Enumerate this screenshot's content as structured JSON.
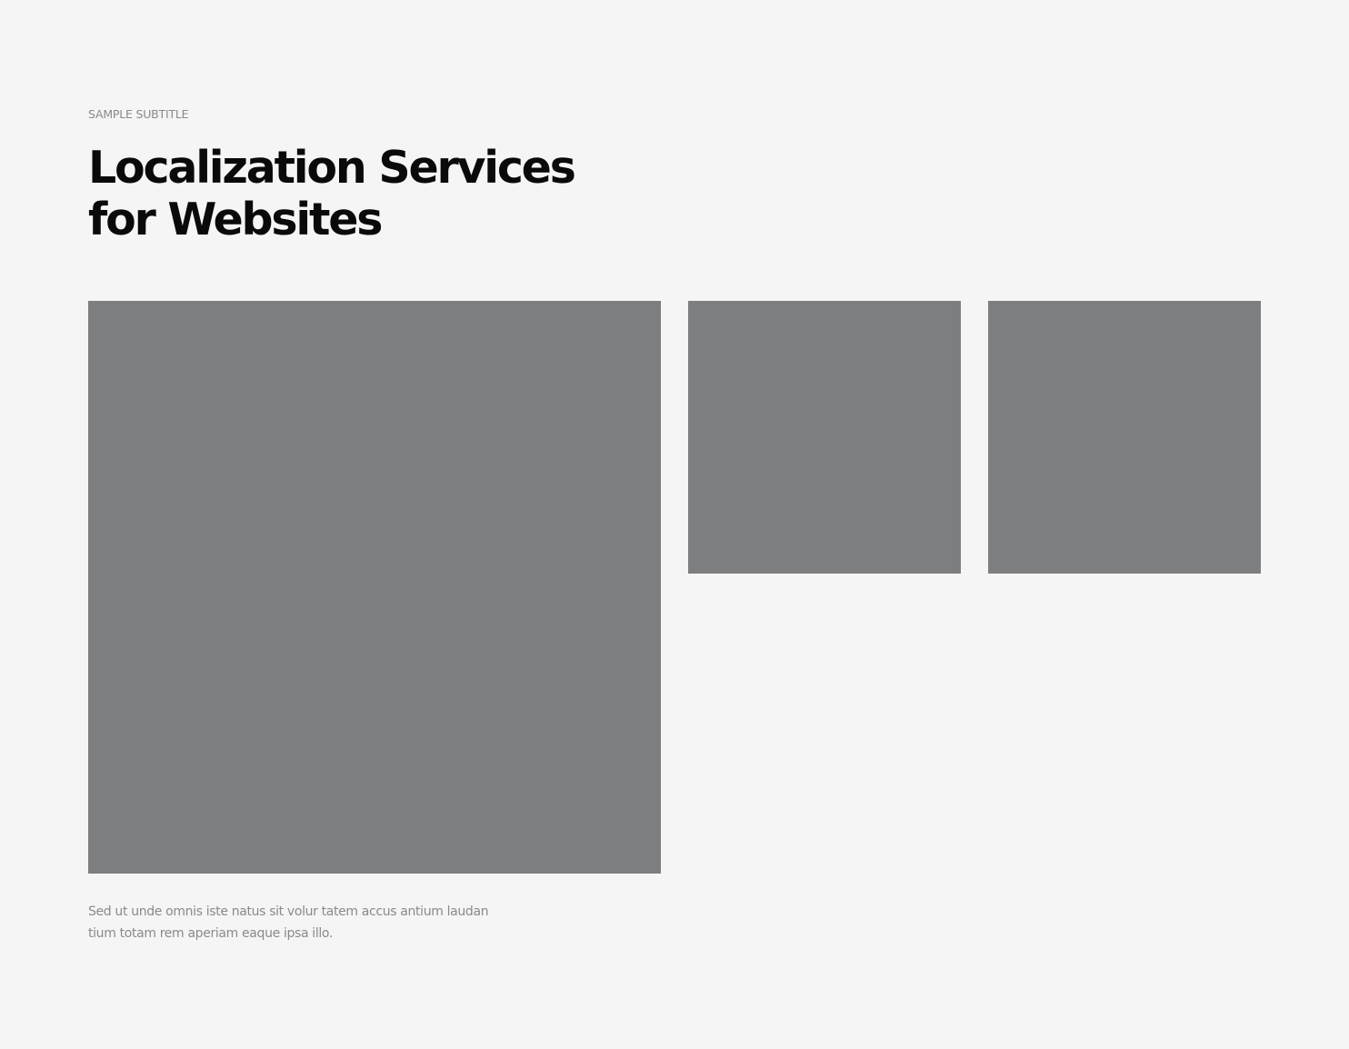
{
  "header": {
    "subtitle": "SAMPLE SUBTITLE",
    "title_line_1": "Localization Services",
    "title_line_2": "for Websites"
  },
  "gallery": {
    "placeholder_color": "#7d7e7f"
  },
  "description": {
    "line_1": "Sed ut unde omnis iste natus sit volur tatem accus antium laudan",
    "line_2": "tium totam rem aperiam eaque ipsa illo."
  },
  "colors": {
    "background": "#f5f5f5",
    "title": "#0a0a0a",
    "muted_text": "#8a8a8a"
  }
}
